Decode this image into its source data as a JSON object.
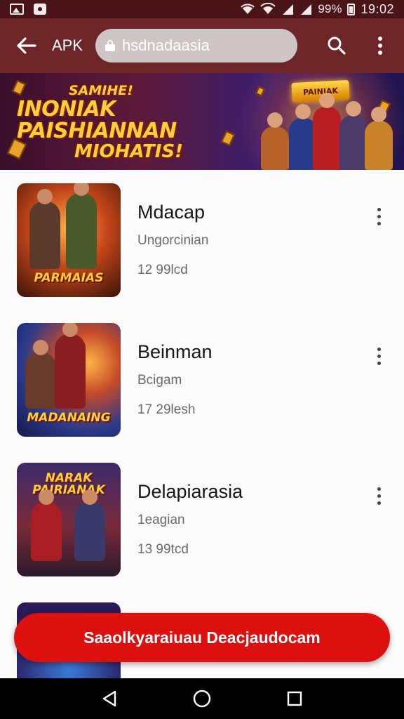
{
  "status_bar": {
    "battery_text": "99%",
    "time": "19:02",
    "icons": [
      "gallery-icon",
      "message-icon",
      "wifi-icon",
      "wifi-icon",
      "signal-icon",
      "signal-icon",
      "battery-icon"
    ]
  },
  "browser": {
    "back_icon": "back-arrow-icon",
    "apk_label": "APK",
    "url": "hsdnadaasia",
    "lock_icon": "lock-icon",
    "search_icon": "search-icon",
    "menu_icon": "more-vert-icon"
  },
  "banner": {
    "line1": "SAMIHE!",
    "line2": "INONIAK PAISHIANNAN",
    "line3": "MIOHATIS!",
    "badge": "PAINIAK"
  },
  "apps": [
    {
      "name": "Mdacap",
      "subtitle": "Ungorcinian",
      "meta": "12 99lcd",
      "thumb_caption": "PARMAIAS"
    },
    {
      "name": "Beinman",
      "subtitle": "Bcigam",
      "meta": "17 29lesh",
      "thumb_caption": "MADANAING"
    },
    {
      "name": "Delapiarasia",
      "subtitle": "1eagian",
      "meta": "13 99tcd",
      "thumb_caption": "NARAK PAIRIANAK"
    }
  ],
  "cta": {
    "label": "Saaolkyaraiuau Deacjaudocam"
  },
  "nav": {
    "icons": [
      "back-triangle-icon",
      "home-circle-icon",
      "recents-square-icon"
    ]
  },
  "colors": {
    "status_bar": "#4a1518",
    "browser_bar": "#6e2528",
    "cta": "#dd1010",
    "nav_bar": "#000000"
  }
}
